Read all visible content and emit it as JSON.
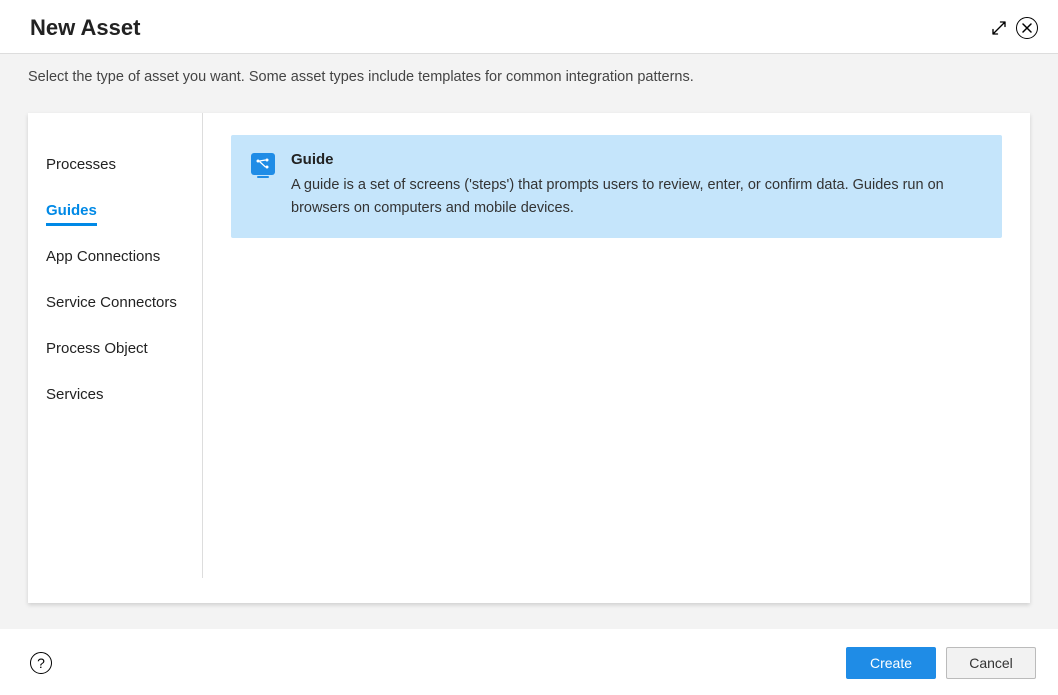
{
  "header": {
    "title": "New Asset"
  },
  "subheader": {
    "text": "Select the type of asset you want. Some asset types include templates for common integration patterns."
  },
  "sidebar": {
    "items": [
      {
        "label": "Processes",
        "active": false
      },
      {
        "label": "Guides",
        "active": true
      },
      {
        "label": "App Connections",
        "active": false
      },
      {
        "label": "Service Connectors",
        "active": false
      },
      {
        "label": "Process Object",
        "active": false
      },
      {
        "label": "Services",
        "active": false
      }
    ]
  },
  "asset": {
    "title": "Guide",
    "description": "A guide is a set of screens ('steps') that prompts users to review, enter, or confirm data. Guides run on browsers on computers and mobile devices."
  },
  "footer": {
    "help": "?",
    "create": "Create",
    "cancel": "Cancel"
  }
}
